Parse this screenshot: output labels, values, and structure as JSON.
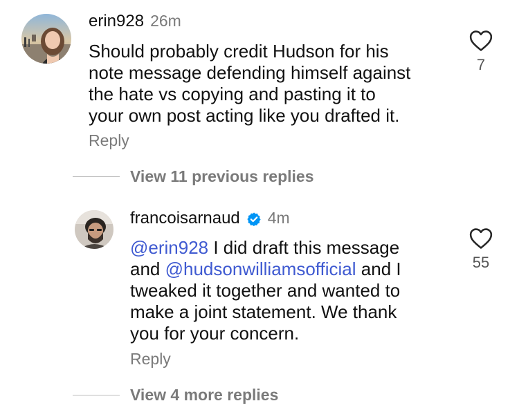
{
  "comments": [
    {
      "username": "erin928",
      "time": "26m",
      "verified": false,
      "lines": [
        "Should probably credit Hudson for his",
        "note message defending himself against",
        "the hate vs copying and pasting it to",
        "your own post acting like you drafted it."
      ],
      "likes": "7",
      "reply_label": "Reply",
      "avatar_icon": "profile-photo"
    },
    {
      "username": "francoisarnaud",
      "time": "4m",
      "verified": true,
      "mention_1": "erin928",
      "line_1_rest": " I did draft this message",
      "line_2_prefix": "and ",
      "mention_2": "hudsonwilliamsofficial",
      "line_2_rest": " and I",
      "lines_rest": [
        "tweaked it together and wanted to",
        "make a joint statement. We thank",
        "you for your concern."
      ],
      "likes": "55",
      "reply_label": "Reply",
      "avatar_icon": "profile-photo"
    }
  ],
  "view_previous": "View 11 previous replies",
  "view_more": "View 4 more replies",
  "mention_glyph": "@",
  "colors": {
    "text": "#111111",
    "muted": "#7a7a7a",
    "mention": "#3f5ad1",
    "verified": "#0095f6",
    "heart_stroke": "#262626"
  },
  "icons": {
    "like": "heart-outline-icon",
    "verified": "verified-badge-icon",
    "mention": "threads-mention-icon"
  }
}
